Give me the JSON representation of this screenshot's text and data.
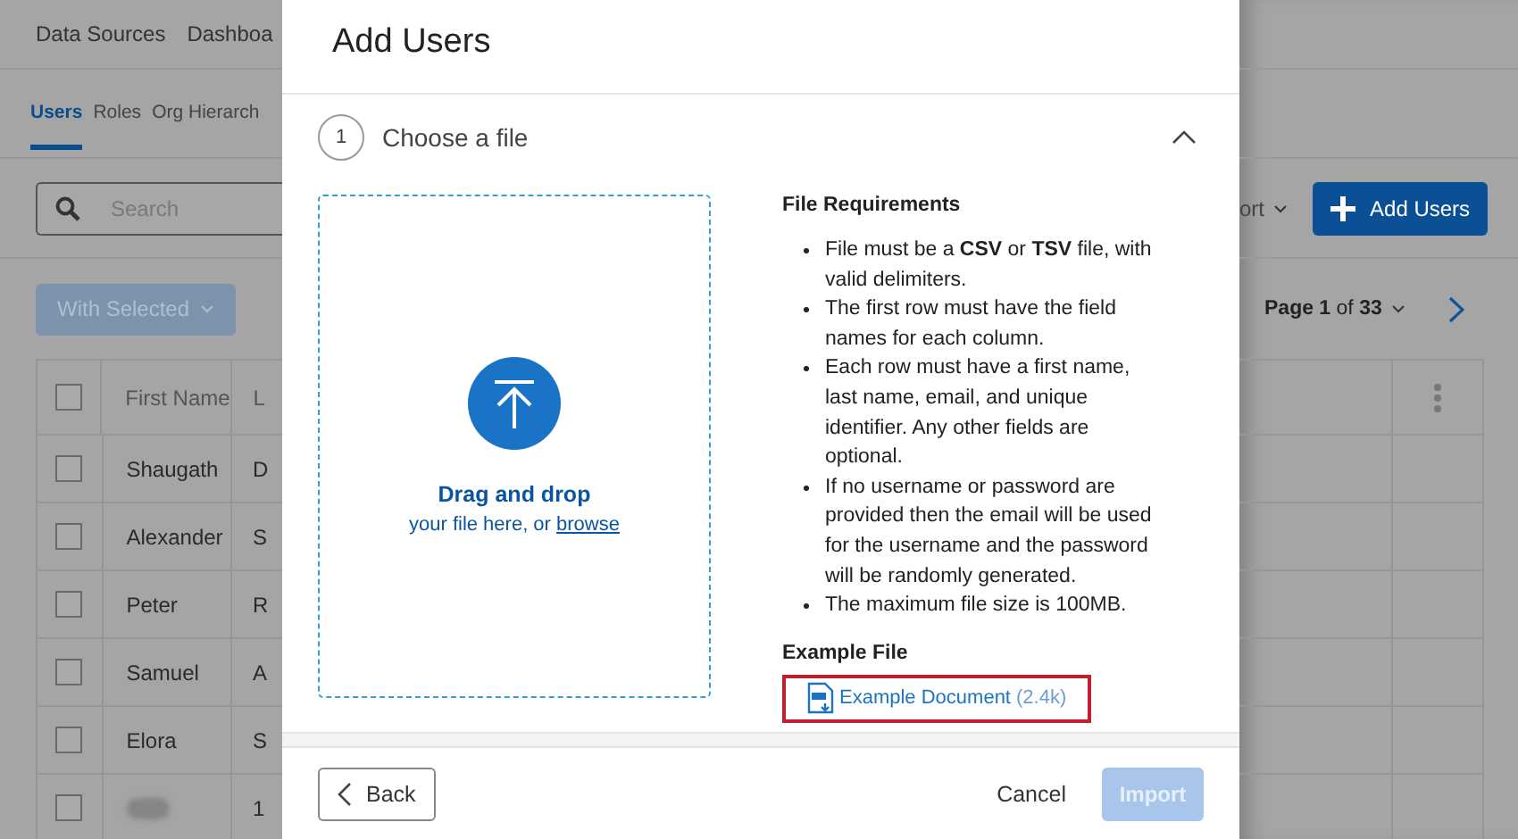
{
  "nav": {
    "items": [
      {
        "label": "Data Sources"
      },
      {
        "label": "Dashboa"
      }
    ]
  },
  "tabs": [
    {
      "label": "Users",
      "selected": true
    },
    {
      "label": "Roles",
      "selected": false
    },
    {
      "label": "Org Hierarch",
      "selected": false
    }
  ],
  "search": {
    "placeholder": "Search"
  },
  "with_selected": {
    "label": "With Selected",
    "disabled": true
  },
  "export_dropdown": {
    "label": "ort"
  },
  "add_users_button": {
    "label": "Add Users"
  },
  "pagination": {
    "label": "**Page 1** of **33**"
  },
  "table": {
    "select_all": {
      "checked": false
    },
    "columns": [
      "First Name",
      "L"
    ],
    "rows": [
      {
        "checked": false,
        "first_name": "Shaugath",
        "last_name": "D"
      },
      {
        "checked": false,
        "first_name": "Alexander",
        "last_name": "S"
      },
      {
        "checked": false,
        "first_name": "Peter",
        "last_name": "R"
      },
      {
        "checked": false,
        "first_name": "Samuel",
        "last_name": "A"
      },
      {
        "checked": false,
        "first_name": "Elora",
        "last_name": "S"
      },
      {
        "checked": false,
        "blurred": true,
        "last_name": "1"
      }
    ]
  },
  "modal": {
    "title": "Add Users",
    "step": {
      "number": "1",
      "title": "Choose a file",
      "expanded": true
    },
    "dropzone": {
      "heading": "Drag and drop",
      "text": "your file here, or ",
      "link": "browse"
    },
    "requirements": {
      "title": "File Requirements",
      "items": [
        "File must be a **CSV** or **TSV** file, with valid delimiters.",
        "The first row must have the field names for each column.",
        "Each row must have a first name, last name, email, and unique identifier. Any other fields are optional.",
        "If no username or password are provided then the email will be used for the username and the password will be randomly generated.",
        "The maximum file size is 100MB."
      ]
    },
    "example": {
      "title": "Example File",
      "link": "Example Document",
      "size": "(2.4k)",
      "highlighted": true
    },
    "footer": {
      "back": "Back",
      "cancel": "Cancel",
      "import": {
        "label": "Import",
        "disabled": true
      }
    }
  }
}
